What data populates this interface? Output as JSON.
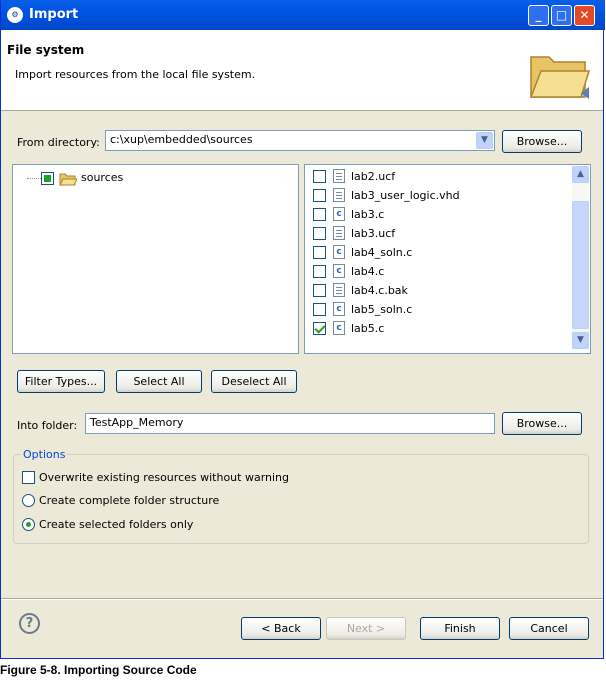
{
  "window": {
    "title": "Import",
    "icon": "eclipse-import-icon"
  },
  "header": {
    "title": "File system",
    "description": "Import resources from the local file system."
  },
  "from_directory": {
    "label": "From directory:",
    "value": "c:\\xup\\embedded\\sources",
    "browse_label": "Browse..."
  },
  "tree": {
    "items": [
      {
        "label": "sources",
        "checked": true
      }
    ]
  },
  "files": [
    {
      "name": "lab2.ucf",
      "type": "file",
      "checked": false
    },
    {
      "name": "lab3_user_logic.vhd",
      "type": "file",
      "checked": false
    },
    {
      "name": "lab3.c",
      "type": "c",
      "checked": false
    },
    {
      "name": "lab3.ucf",
      "type": "file",
      "checked": false
    },
    {
      "name": "lab4_soln.c",
      "type": "c",
      "checked": false
    },
    {
      "name": "lab4.c",
      "type": "c",
      "checked": false
    },
    {
      "name": "lab4.c.bak",
      "type": "file",
      "checked": false
    },
    {
      "name": "lab5_soln.c",
      "type": "c",
      "checked": false
    },
    {
      "name": "lab5.c",
      "type": "c",
      "checked": true
    }
  ],
  "selection_buttons": {
    "filter_types": "Filter Types...",
    "select_all": "Select All",
    "deselect_all": "Deselect All"
  },
  "into_folder": {
    "label": "Into folder:",
    "value": "TestApp_Memory",
    "browse_label": "Browse..."
  },
  "options": {
    "legend": "Options",
    "overwrite": {
      "label": "Overwrite existing resources without warning",
      "checked": false
    },
    "complete_structure": {
      "label": "Create complete folder structure",
      "selected": false
    },
    "selected_only": {
      "label": "Create selected folders only",
      "selected": true
    }
  },
  "footer": {
    "back": "< Back",
    "next": "Next >",
    "finish": "Finish",
    "cancel": "Cancel"
  },
  "caption": "Figure 5-8. Importing Source Code",
  "colors": {
    "title_bar": "#0054e3",
    "dialog_bg": "#ece9d8",
    "check": "#21a121",
    "options_legend": "#0046d5"
  }
}
